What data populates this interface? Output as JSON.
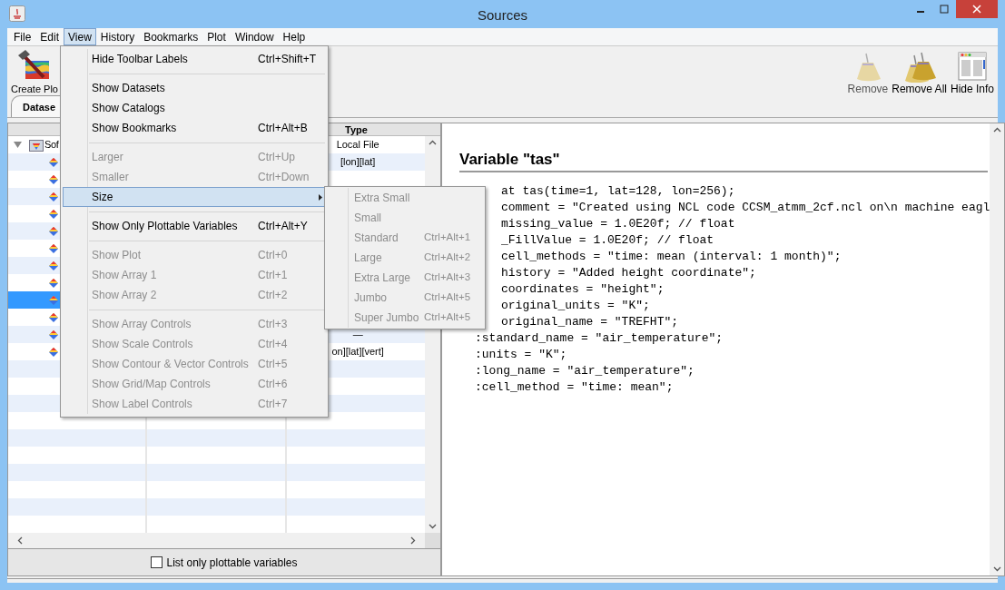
{
  "window": {
    "title": "Sources"
  },
  "menu_bar": [
    {
      "label": "File",
      "selected": false
    },
    {
      "label": "Edit",
      "selected": false
    },
    {
      "label": "View",
      "selected": true
    },
    {
      "label": "History",
      "selected": false
    },
    {
      "label": "Bookmarks",
      "selected": false
    },
    {
      "label": "Plot",
      "selected": false
    },
    {
      "label": "Window",
      "selected": false
    },
    {
      "label": "Help",
      "selected": false
    }
  ],
  "toolbar": {
    "left": [
      {
        "label": "Create Plo",
        "disabled": false
      }
    ],
    "right": [
      {
        "kind": "broom",
        "label": "Remove",
        "disabled": true
      },
      {
        "kind": "brooms",
        "label": "Remove All",
        "disabled": false
      },
      {
        "kind": "info",
        "label": "Hide Info",
        "disabled": false
      }
    ]
  },
  "tabs": [
    {
      "label": "Datase",
      "selected": true
    }
  ],
  "table": {
    "columns": [
      {
        "label": "Type"
      }
    ],
    "rows": [
      {
        "name": "Sof",
        "type": "Local File",
        "selected": false,
        "expanded": true,
        "children": [
          {
            "type": "[lon][lat]",
            "selected": false
          },
          {
            "selected": false
          },
          {
            "selected": false
          },
          {
            "selected": false
          },
          {
            "selected": false
          },
          {
            "selected": false
          },
          {
            "selected": false
          },
          {
            "selected": false
          },
          {
            "selected": true
          },
          {
            "selected": false
          },
          {
            "type": "—",
            "selected": false
          },
          {
            "type": "on][lat][vert]",
            "selected": false
          }
        ]
      }
    ]
  },
  "filter_checkbox": {
    "label": "List only plottable variables",
    "checked": false
  },
  "info": {
    "heading": "Variable \"tas\"",
    "lines": [
      {
        "kind": "cut",
        "text": "at tas(time=1, lat=128, lon=256);"
      },
      {
        "kind": "cut",
        "text": "comment = \"Created using NCL code CCSM_atmm_2cf.ncl on\\n machine eagl"
      },
      {
        "kind": "cut",
        "text": "missing_value = 1.0E20f; // float"
      },
      {
        "kind": "cut",
        "text": "_FillValue = 1.0E20f; // float"
      },
      {
        "kind": "cut",
        "text": "cell_methods = \"time: mean (interval: 1 month)\";"
      },
      {
        "kind": "cut",
        "text": "history = \"Added height coordinate\";"
      },
      {
        "kind": "cut",
        "text": "coordinates = \"height\";"
      },
      {
        "kind": "cut",
        "text": "original_units = \"K\";"
      },
      {
        "kind": "cut",
        "text": "original_name = \"TREFHT\";"
      },
      {
        "kind": "full",
        "text": ":standard_name = \"air_temperature\";"
      },
      {
        "kind": "full",
        "text": ":units = \"K\";"
      },
      {
        "kind": "full",
        "text": ":long_name = \"air_temperature\";"
      },
      {
        "kind": "full",
        "text": ":cell_method = \"time: mean\";"
      }
    ]
  },
  "view_menu": {
    "items": [
      {
        "kind": "item",
        "label": "Hide Toolbar Labels",
        "shortcut": "Ctrl+Shift+T",
        "disabled": false
      },
      {
        "kind": "separator"
      },
      {
        "kind": "item",
        "label": "Show Datasets",
        "disabled": false
      },
      {
        "kind": "item",
        "label": "Show Catalogs",
        "disabled": false
      },
      {
        "kind": "item",
        "label": "Show Bookmarks",
        "shortcut": "Ctrl+Alt+B",
        "disabled": false
      },
      {
        "kind": "separator"
      },
      {
        "kind": "item",
        "label": "Larger",
        "shortcut": "Ctrl+Up",
        "disabled": true
      },
      {
        "kind": "item",
        "label": "Smaller",
        "shortcut": "Ctrl+Down",
        "disabled": true
      },
      {
        "kind": "submenu",
        "label": "Size",
        "selected": true,
        "disabled": false
      },
      {
        "kind": "separator"
      },
      {
        "kind": "item",
        "label": "Show Only Plottable Variables",
        "shortcut": "Ctrl+Alt+Y",
        "disabled": false
      },
      {
        "kind": "separator"
      },
      {
        "kind": "item",
        "label": "Show Plot",
        "shortcut": "Ctrl+0",
        "disabled": true
      },
      {
        "kind": "item",
        "label": "Show Array 1",
        "shortcut": "Ctrl+1",
        "disabled": true
      },
      {
        "kind": "item",
        "label": "Show Array 2",
        "shortcut": "Ctrl+2",
        "disabled": true
      },
      {
        "kind": "separator"
      },
      {
        "kind": "item",
        "label": "Show Array Controls",
        "shortcut": "Ctrl+3",
        "disabled": true
      },
      {
        "kind": "item",
        "label": "Show Scale Controls",
        "shortcut": "Ctrl+4",
        "disabled": true
      },
      {
        "kind": "item",
        "label": "Show Contour & Vector Controls",
        "shortcut": "Ctrl+5",
        "disabled": true
      },
      {
        "kind": "item",
        "label": "Show Grid/Map Controls",
        "shortcut": "Ctrl+6",
        "disabled": true
      },
      {
        "kind": "item",
        "label": "Show Label Controls",
        "shortcut": "Ctrl+7",
        "disabled": true
      }
    ]
  },
  "size_submenu": {
    "items": [
      {
        "label": "Extra Small",
        "disabled": true
      },
      {
        "label": "Small",
        "disabled": true
      },
      {
        "label": "Standard",
        "shortcut": "Ctrl+Alt+1",
        "disabled": true
      },
      {
        "label": "Large",
        "shortcut": "Ctrl+Alt+2",
        "disabled": true
      },
      {
        "label": "Extra Large",
        "shortcut": "Ctrl+Alt+3",
        "disabled": true
      },
      {
        "label": "Jumbo",
        "shortcut": "Ctrl+Alt+5",
        "disabled": true
      },
      {
        "label": "Super Jumbo",
        "shortcut": "Ctrl+Alt+5",
        "disabled": true
      }
    ]
  }
}
